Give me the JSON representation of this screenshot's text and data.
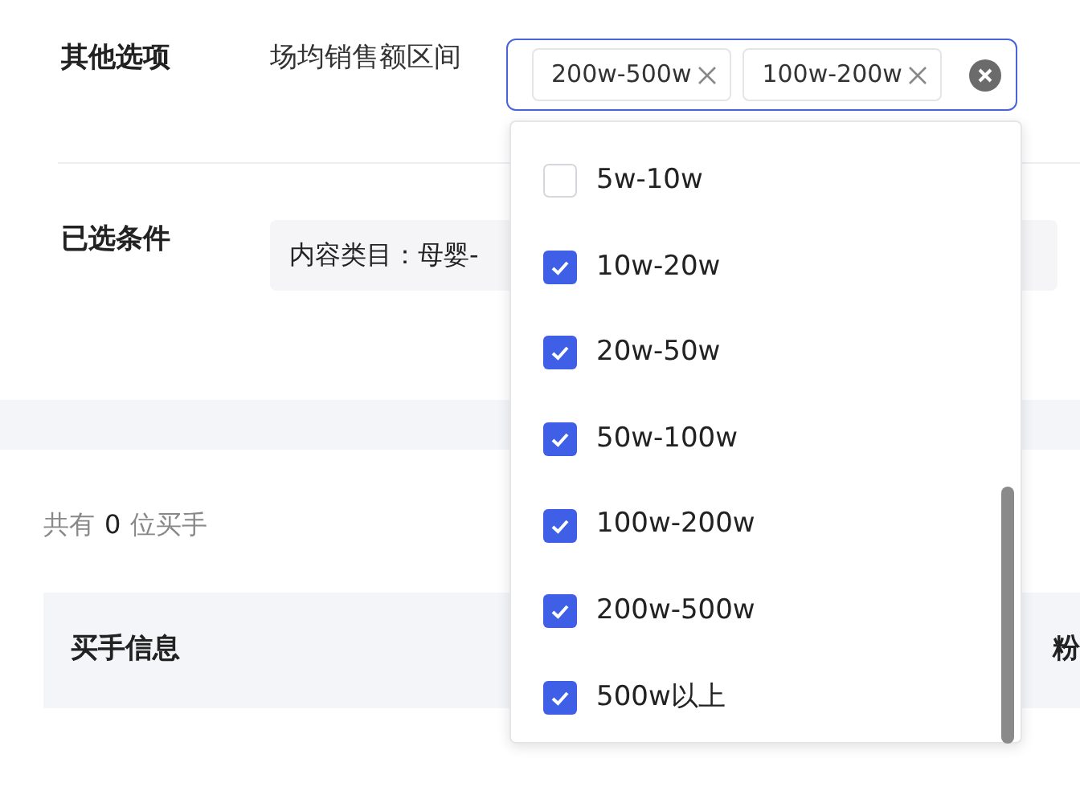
{
  "other_options": {
    "label": "其他选项",
    "field_label": "场均销售额区间",
    "tags": [
      {
        "text": "200w-500w"
      },
      {
        "text": "100w-200w"
      }
    ]
  },
  "selected_conditions": {
    "label": "已选条件",
    "chip": "内容类目：母婴-"
  },
  "summary": {
    "prefix": "共有",
    "count": "0",
    "suffix": "位买手"
  },
  "table": {
    "columns": [
      "买手信息",
      "粉"
    ]
  },
  "dropdown": {
    "options": [
      {
        "label": "5w-10w",
        "checked": false
      },
      {
        "label": "10w-20w",
        "checked": true
      },
      {
        "label": "20w-50w",
        "checked": true
      },
      {
        "label": "50w-100w",
        "checked": true
      },
      {
        "label": "100w-200w",
        "checked": true
      },
      {
        "label": "200w-500w",
        "checked": true
      },
      {
        "label": "500w以上",
        "checked": true
      }
    ]
  }
}
